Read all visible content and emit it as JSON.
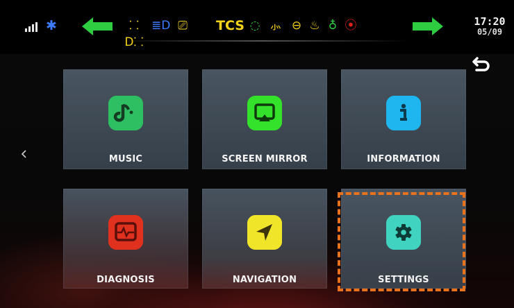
{
  "status_bar": {
    "time": "17:20",
    "date": "05/09",
    "tcs_label": "TCS",
    "indicators": [
      {
        "name": "signal-icon",
        "color": "#e8e8e8"
      },
      {
        "name": "bluetooth-icon",
        "color": "#3d7cff"
      },
      {
        "name": "left-turn-arrow-icon",
        "color": "#2ecc40"
      },
      {
        "name": "fog-lamp-icon",
        "color": "#f3d21a"
      },
      {
        "name": "high-beam-icon",
        "color": "#3d7cff"
      },
      {
        "name": "battery-warning-icon",
        "color": "#f3d21a"
      },
      {
        "name": "abs-warning-icon",
        "color": "#2ecc40"
      },
      {
        "name": "oil-warning-icon",
        "color": "#f3d21a"
      },
      {
        "name": "temperature-icon",
        "color": "#f3d21a"
      },
      {
        "name": "engine-icon",
        "color": "#f3d21a"
      },
      {
        "name": "fuel-icon",
        "color": "#2ecc40"
      },
      {
        "name": "alert-icon",
        "color": "#e02020"
      },
      {
        "name": "right-turn-arrow-icon",
        "color": "#2ecc40"
      }
    ]
  },
  "menu": {
    "tiles": [
      {
        "label": "MUSIC",
        "icon": "music-icon",
        "color": "#2ebf63"
      },
      {
        "label": "SCREEN MIRROR",
        "icon": "screen-mirror-icon",
        "color": "#34e22c"
      },
      {
        "label": "INFORMATION",
        "icon": "info-icon",
        "color": "#1fb5ee"
      },
      {
        "label": "DIAGNOSIS",
        "icon": "diagnosis-icon",
        "color": "#e0301e"
      },
      {
        "label": "NAVIGATION",
        "icon": "navigation-icon",
        "color": "#f1e52a"
      },
      {
        "label": "SETTINGS",
        "icon": "settings-icon",
        "color": "#3fd3c0"
      }
    ],
    "highlighted": "SETTINGS",
    "highlight_color": "#e8731c"
  }
}
